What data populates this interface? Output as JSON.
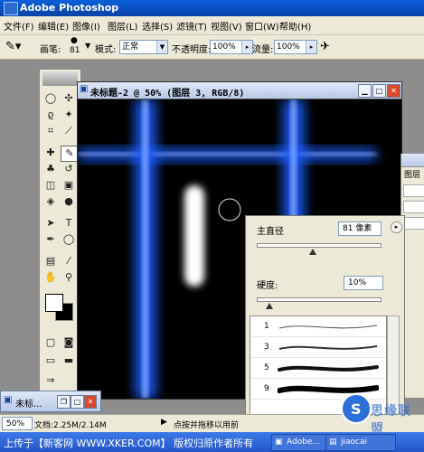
{
  "app": {
    "title": "Adobe Photoshop"
  },
  "menu": [
    "文件(F)",
    "编辑(E)",
    "图像(I)",
    "图层(L)",
    "选择(S)",
    "滤镜(T)",
    "视图(V)",
    "窗口(W)",
    "帮助(H)"
  ],
  "options_bar": {
    "brush_label": "画笔:",
    "brush_size": "81",
    "mode_label": "模式:",
    "mode_value": "正常",
    "opacity_label": "不透明度:",
    "opacity_value": "100%",
    "flow_label": "流量:",
    "flow_value": "100%"
  },
  "document": {
    "title": "未标题-2 @ 50% (图层 3, RGB/8)",
    "zoom": "50%",
    "doc_size": "文档:2.25M/2.14M",
    "status_hint": "点按并拖移以用前"
  },
  "brush_panel": {
    "diameter_label": "主直径",
    "diameter_value": "81 像素",
    "hardness_label": "硬度:",
    "hardness_value": "10%",
    "diameter_fraction": 0.45,
    "hardness_fraction": 0.1,
    "brushes": [
      {
        "number": "1"
      },
      {
        "number": "3"
      },
      {
        "number": "5"
      },
      {
        "number": "9"
      }
    ]
  },
  "layers_panel": {
    "title": "图层"
  },
  "minimized_window": {
    "title": "未标..."
  },
  "taskbar": {
    "credit": "上传于【新客网 WWW.XKER.COM】 版权归原作者所有",
    "tasks": [
      "Adobe...",
      "jiaocai"
    ]
  },
  "watermark": {
    "text": "思缘联盟"
  },
  "colors": {
    "title_bar": "#0842a8",
    "glow": "#2b6cff",
    "ui_bg": "#ece9d8",
    "canvas": "#000000"
  }
}
